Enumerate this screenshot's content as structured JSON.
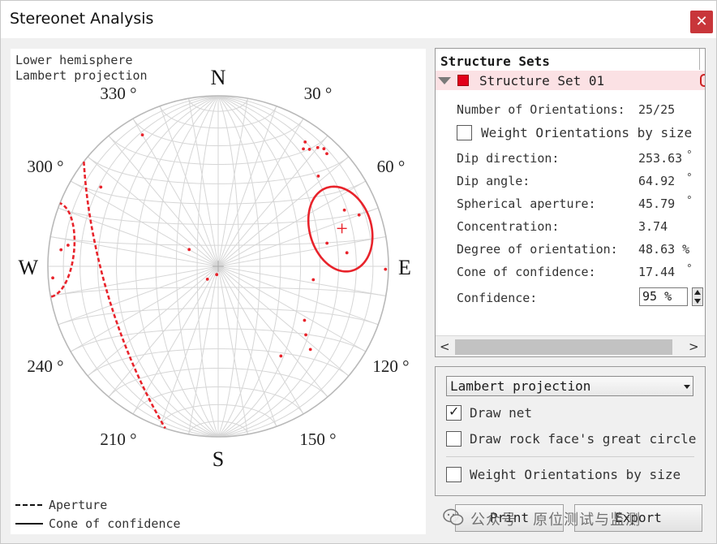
{
  "window": {
    "title": "Stereonet Analysis",
    "close_glyph": "✕"
  },
  "stereonet": {
    "info_line1": "Lower hemisphere",
    "info_line2": "Lambert projection",
    "compass": {
      "north": "N",
      "south": "S",
      "east": "E",
      "west": "W"
    },
    "angle_labels": [
      {
        "text": "30",
        "suffix": "°"
      },
      {
        "text": "60",
        "suffix": "°"
      },
      {
        "text": "120",
        "suffix": "°"
      },
      {
        "text": "150",
        "suffix": "°"
      },
      {
        "text": "210",
        "suffix": "°"
      },
      {
        "text": "240",
        "suffix": "°"
      },
      {
        "text": "300",
        "suffix": "°"
      },
      {
        "text": "330",
        "suffix": "°"
      }
    ],
    "legend": {
      "aperture": "Aperture",
      "cone": "Cone of confidence"
    },
    "colors": {
      "data": "#e8232b",
      "net": "#d6d6d6",
      "primitive": "#b9b9b9"
    },
    "mean": {
      "trend": 73,
      "plunge": 25
    },
    "cone_of_confidence_deg": 17.44,
    "points": [
      {
        "trend": 330,
        "plunge": 12
      },
      {
        "trend": 304,
        "plunge": 18
      },
      {
        "trend": 278,
        "plunge": 12
      },
      {
        "trend": 276,
        "plunge": 8
      },
      {
        "trend": 266,
        "plunge": 3
      },
      {
        "trend": 300,
        "plunge": 74
      },
      {
        "trend": 220,
        "plunge": 82
      },
      {
        "trend": 190,
        "plunge": 86
      },
      {
        "trend": 98,
        "plunge": 43
      },
      {
        "trend": 122,
        "plunge": 40
      },
      {
        "trend": 128,
        "plunge": 35
      },
      {
        "trend": 132,
        "plunge": 28
      },
      {
        "trend": 145,
        "plunge": 36
      },
      {
        "trend": 84,
        "plunge": 25
      },
      {
        "trend": 66,
        "plunge": 20
      },
      {
        "trend": 70,
        "plunge": 13
      },
      {
        "trend": 78,
        "plunge": 35
      },
      {
        "trend": 48,
        "plunge": 22
      },
      {
        "trend": 35,
        "plunge": 12
      },
      {
        "trend": 36,
        "plunge": 16
      },
      {
        "trend": 42,
        "plunge": 8
      },
      {
        "trend": 40,
        "plunge": 10
      },
      {
        "trend": 44,
        "plunge": 9
      },
      {
        "trend": 91,
        "plunge": 2
      },
      {
        "trend": 38,
        "plunge": 14
      }
    ]
  },
  "structure_sets": {
    "header": "Structure Sets",
    "set": {
      "name": "Structure Set 01",
      "color": "#e2001a"
    },
    "properties": {
      "num_label": "Number of Orientations:",
      "num_value": "25/25",
      "weight_label": "Weight Orientations by size",
      "dip_direction_label": "Dip direction:",
      "dip_direction_value": "253.63",
      "dip_angle_label": "Dip angle:",
      "dip_angle_value": "64.92",
      "aperture_label": "Spherical aperture:",
      "aperture_value": "45.79",
      "concentration_label": "Concentration:",
      "concentration_value": "3.74",
      "orientation_label": "Degree of orientation:",
      "orientation_value": "48.63 %",
      "cone_label": "Cone of confidence:",
      "cone_value": "17.44",
      "confidence_label": "Confidence:",
      "confidence_value": "95 %",
      "degree_symbol": "°"
    }
  },
  "options": {
    "projection_value": "Lambert projection",
    "draw_net_label": "Draw net",
    "draw_net_checked": "✓",
    "draw_rockface_label": "Draw rock face's great circle",
    "weight_label": "Weight Orientations by size"
  },
  "buttons": {
    "print": "Print",
    "export": "Export"
  },
  "watermark": "公众号 · 原位测试与监测"
}
